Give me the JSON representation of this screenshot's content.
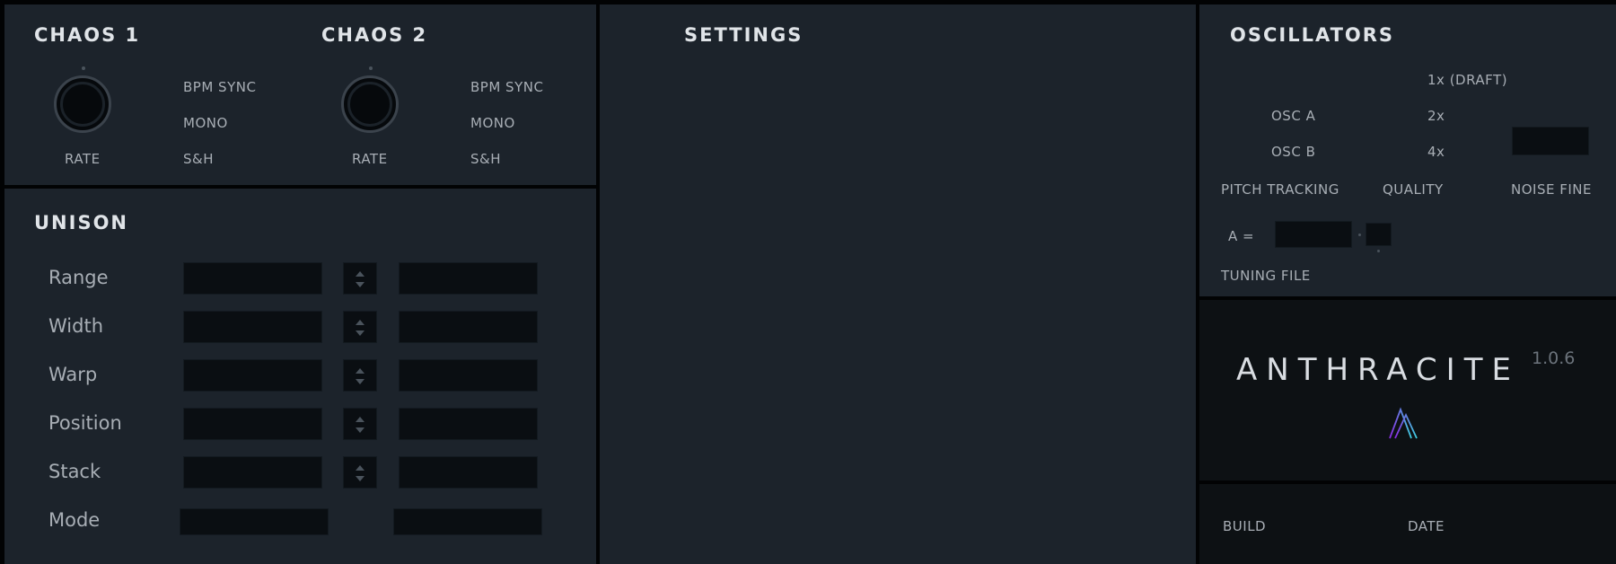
{
  "chaos1": {
    "title": "CHAOS 1",
    "knob_label": "RATE",
    "options": [
      "BPM SYNC",
      "MONO",
      "S&H"
    ]
  },
  "chaos2": {
    "title": "CHAOS 2",
    "knob_label": "RATE",
    "options": [
      "BPM SYNC",
      "MONO",
      "S&H"
    ]
  },
  "unison": {
    "title": "UNISON",
    "rows": [
      "Range",
      "Width",
      "Warp",
      "Position",
      "Stack"
    ],
    "mode_label": "Mode"
  },
  "settings": {
    "title": "SETTINGS"
  },
  "oscillators": {
    "title": "OSCILLATORS",
    "osc_a": "OSC A",
    "osc_b": "OSC B",
    "quality_options": [
      "1x (DRAFT)",
      "2x",
      "4x"
    ],
    "pitch_tracking": "PITCH TRACKING",
    "quality": "QUALITY",
    "noise_fine": "NOISE FINE",
    "a_equals": "A =",
    "tuning_file": "TUNING FILE"
  },
  "about": {
    "brand": "ANTHRACITE",
    "version": "1.0.6",
    "build_label": "BUILD",
    "date_label": "DATE",
    "logo_icon": "anthracite-logo-icon",
    "logo_colors": [
      "#8a2be2",
      "#3ecfe0"
    ]
  }
}
